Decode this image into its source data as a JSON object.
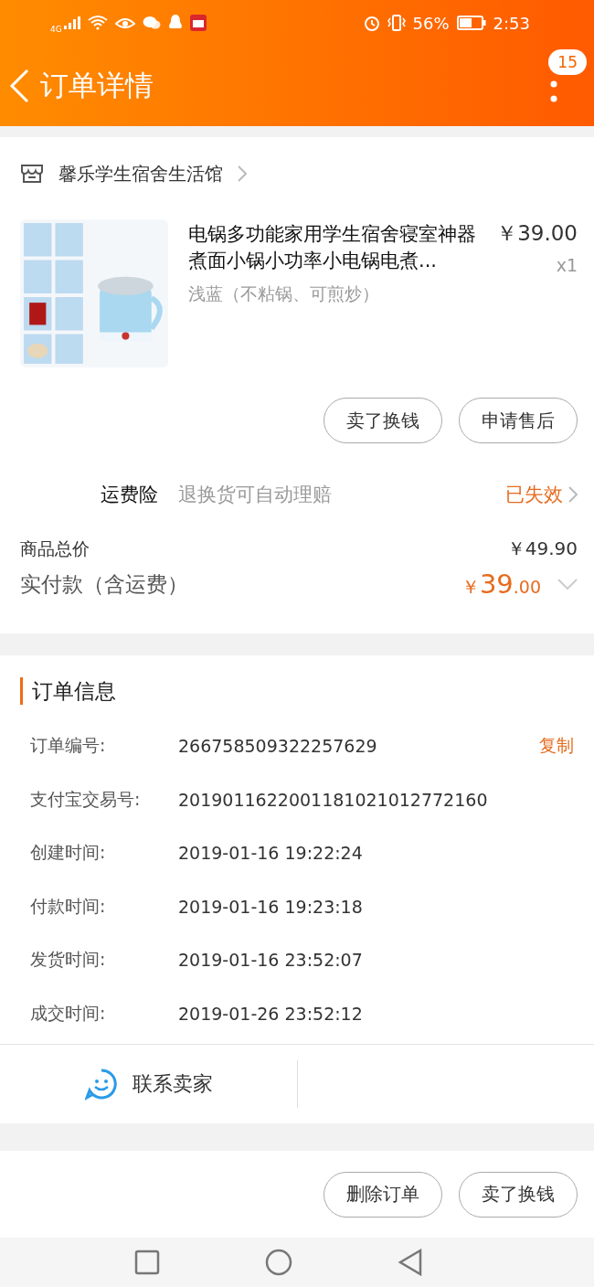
{
  "status_bar": {
    "network": "4G",
    "battery": "56%",
    "time": "2:53"
  },
  "header": {
    "title": "订单详情",
    "badge": "15"
  },
  "store": {
    "name": "馨乐学生宿舍生活馆"
  },
  "product": {
    "title": "电锅多功能家用学生宿舍寝室神器煮面小锅小功率小电锅电煮...",
    "price": "￥39.00",
    "quantity": "x1",
    "sku": "浅蓝（不粘锅、可煎炒）"
  },
  "item_actions": [
    "卖了换钱",
    "申请售后"
  ],
  "insurance": {
    "label": "运费险",
    "description": "退换货可自动理赔",
    "status": "已失效"
  },
  "totals": {
    "goods_label": "商品总价",
    "goods_value": "￥49.90",
    "paid_label": "实付款（含运费）",
    "paid_amount": {
      "currency": "￥",
      "integer": "39",
      "decimal": ".00"
    }
  },
  "order_info": {
    "title": "订单信息",
    "rows": [
      {
        "label": "订单编号:",
        "value": "266758509322257629",
        "action": "复制"
      },
      {
        "label": "支付宝交易号:",
        "value": "2019011622001181021012772160"
      },
      {
        "label": "创建时间:",
        "value": "2019-01-16 19:22:24"
      },
      {
        "label": "付款时间:",
        "value": "2019-01-16 19:23:18"
      },
      {
        "label": "发货时间:",
        "value": "2019-01-16 23:52:07"
      },
      {
        "label": "成交时间:",
        "value": "2019-01-26 23:52:12"
      }
    ]
  },
  "contact": {
    "label": "联系卖家"
  },
  "bottom_actions": [
    "删除订单",
    "卖了换钱"
  ]
}
